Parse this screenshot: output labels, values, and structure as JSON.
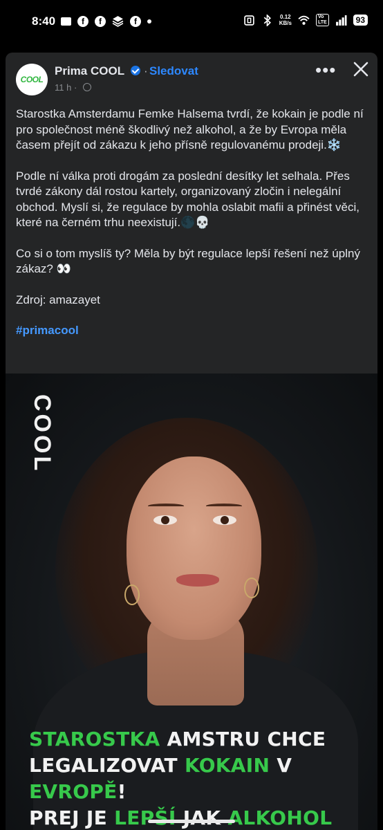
{
  "status_bar": {
    "time": "8:40",
    "net_speed_value": "0.12",
    "net_speed_unit": "KB/s",
    "volte_top": "Vo",
    "volte_bottom": "LTE",
    "battery": "93",
    "left_icons": [
      "mail-icon",
      "facebook-icon",
      "facebook-icon",
      "stack-icon",
      "facebook-icon",
      "dot-icon"
    ],
    "right_icons": [
      "nfc-icon",
      "bluetooth-icon",
      "wifi-icon",
      "signal-icon"
    ]
  },
  "post": {
    "page_name": "Prima COOL",
    "avatar_text": "COOL",
    "separator": "·",
    "follow_label": "Sledovat",
    "time": "11 h ·",
    "paragraphs": [
      "Starostka Amsterdamu Femke Halsema tvrdí, že kokain je podle ní pro společnost méně škodlivý než alkohol, a že by Evropa měla časem přejít od zákazu k jeho přísně regulovanému prodeji.❄️",
      "Podle ní válka proti drogám za poslední desítky let selhala. Přes tvrdé zákony dál rostou kartely, organizovaný zločin i nelegální obchod. Myslí si, že regulace by mohla oslabit mafii a přinést věci, které na černém trhu neexistují.🌑💀",
      "Co si o tom myslíš ty? Měla by být regulace lepší řešení než úplný zákaz? 👀",
      "Zdroj: amazayet"
    ],
    "hashtag": "#primacool"
  },
  "image": {
    "logo_text": "COOL",
    "headline_line1": [
      {
        "text": "STAROSTKA ",
        "green": true
      },
      {
        "text": "AMSTRU CHCE",
        "green": false
      }
    ],
    "headline_line2": [
      {
        "text": "LEGALIZOVAT ",
        "green": false
      },
      {
        "text": "KOKAIN",
        "green": true
      },
      {
        "text": " V ",
        "green": false
      },
      {
        "text": "EVROPĚ",
        "green": true
      },
      {
        "text": "!",
        "green": false
      }
    ],
    "headline_line3": [
      {
        "text": "PREJ JE ",
        "green": false
      },
      {
        "text": "LEPŠÍ",
        "green": true
      },
      {
        "text": " JAK ",
        "green": false
      },
      {
        "text": "ALKOHOL",
        "green": true
      }
    ]
  },
  "colors": {
    "accent_green": "#37c94b",
    "link_blue": "#2d88ff",
    "card_bg": "#242526"
  }
}
